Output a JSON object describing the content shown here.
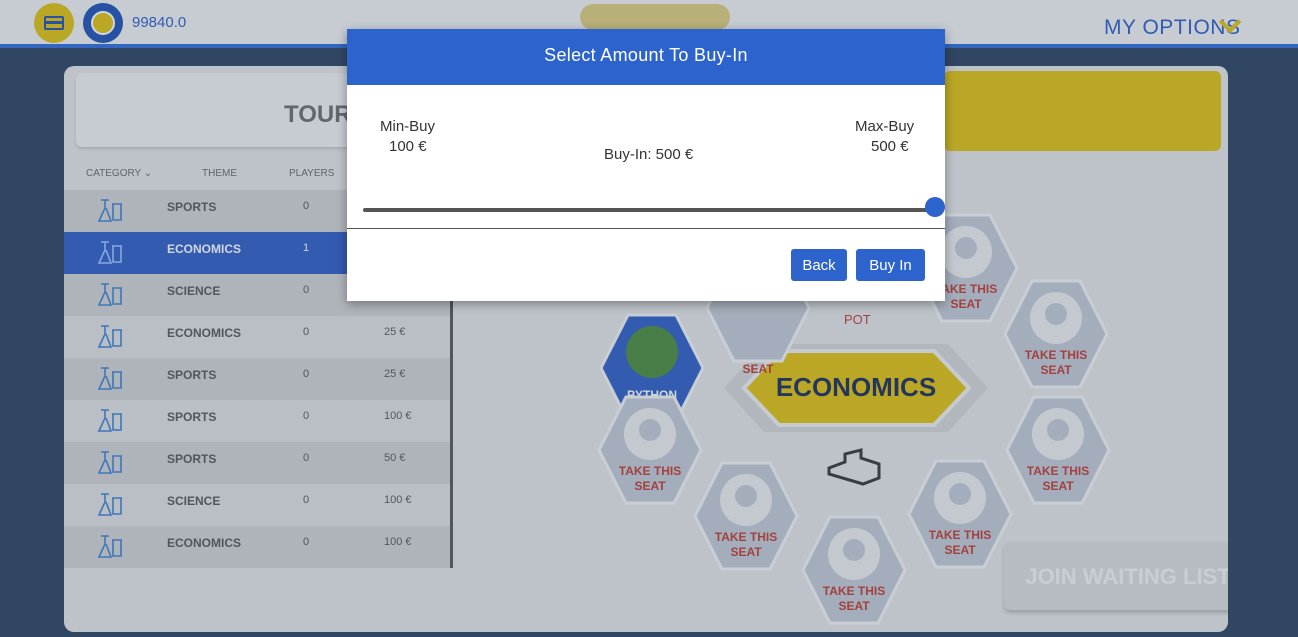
{
  "topbar": {
    "balance": "99840.0",
    "my_options": "MY OPTIONS"
  },
  "lobby": {
    "banner_title": "TOURN",
    "columns": {
      "category": "CATEGORY ⌄",
      "theme": "THEME",
      "players": "PLAYERS"
    },
    "rows": [
      {
        "theme": "SPORTS",
        "players": "0",
        "fee": ""
      },
      {
        "theme": "ECONOMICS",
        "players": "1",
        "fee": ""
      },
      {
        "theme": "SCIENCE",
        "players": "0",
        "fee": ""
      },
      {
        "theme": "ECONOMICS",
        "players": "0",
        "fee": "25 €"
      },
      {
        "theme": "SPORTS",
        "players": "0",
        "fee": "25 €"
      },
      {
        "theme": "SPORTS",
        "players": "0",
        "fee": "100 €"
      },
      {
        "theme": "SPORTS",
        "players": "0",
        "fee": "50 €"
      },
      {
        "theme": "SCIENCE",
        "players": "0",
        "fee": "100 €"
      },
      {
        "theme": "ECONOMICS",
        "players": "0",
        "fee": "100 €"
      }
    ]
  },
  "table": {
    "center_label": "ECONOMICS",
    "pot_label": "POT",
    "occupied_seat_name": "PYTHON",
    "empty_seat_line1": "TAKE THIS",
    "empty_seat_line2": "SEAT",
    "partial_seat_label": "SEAT",
    "join_waiting_list": "JOIN WAITING LIST"
  },
  "modal": {
    "title": "Select Amount To Buy-In",
    "min_label": "Min-Buy",
    "min_value": "100 €",
    "max_label": "Max-Buy",
    "max_value": "500 €",
    "buyin_text": "Buy-In: 500 €",
    "slider_fraction": 1.0,
    "back_label": "Back",
    "buyin_label": "Buy In"
  },
  "colors": {
    "accent": "#2d63cc",
    "gold": "#e2c10b",
    "seat_text": "#c0392b"
  }
}
